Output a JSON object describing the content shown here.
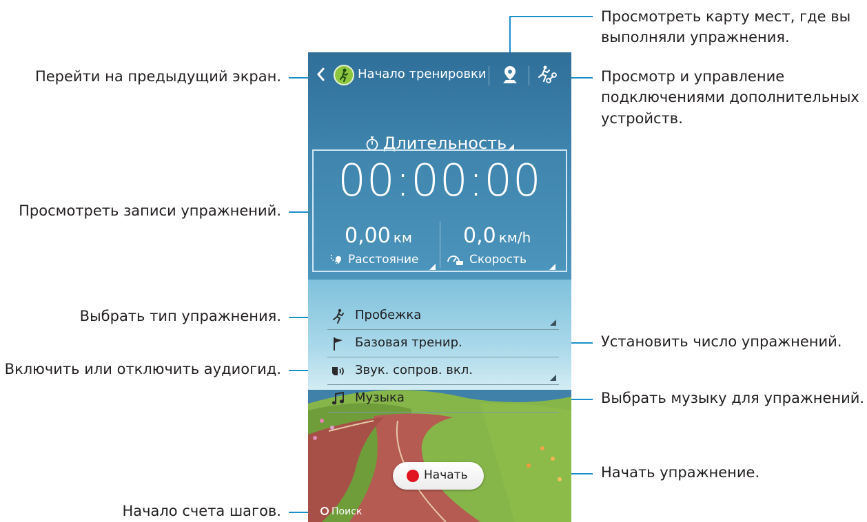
{
  "annotations": {
    "back": "Перейти на предыдущий экран.",
    "records": "Просмотреть записи упражнений.",
    "type": "Выбрать тип упражнения.",
    "audio": "Включить или отключить аудиогид.",
    "steps": "Начало счета шагов.",
    "map_line1": "Просмотреть карту мест, где вы",
    "map_line2": "выполняли упражнения.",
    "acc_line1": "Просмотр и управление",
    "acc_line2": "подключениями дополнительных",
    "acc_line3": "устройств.",
    "count": "Установить число упражнений.",
    "music": "Выбрать музыку для упражнений.",
    "start": "Начать упражнение."
  },
  "screen": {
    "title": "Начало тренировки",
    "mode": "Длительность",
    "timer": "00:00:00",
    "distance_value": "0,00",
    "distance_unit": "км",
    "distance_label": "Расстояние",
    "speed_value": "0,0",
    "speed_unit": "км/h",
    "speed_label": "Скорость",
    "rows": {
      "type": "Пробежка",
      "workout": "Базовая тренир.",
      "audio": "Звук. сопров. вкл.",
      "music": "Музыка"
    },
    "start_label": "Начать",
    "search_label": "Поиск"
  },
  "icons": [
    "back-icon",
    "running-app-icon",
    "map-pin-icon",
    "accessory-icon",
    "stopwatch-icon",
    "distance-icon",
    "speed-icon",
    "running-icon",
    "flag-icon",
    "speaker-icon",
    "music-note-icon",
    "record-dot-icon",
    "location-icon"
  ],
  "colors": {
    "accent_line": "#1a90c8",
    "app_icon": "#8cc63f",
    "record_dot": "#e0141e"
  }
}
